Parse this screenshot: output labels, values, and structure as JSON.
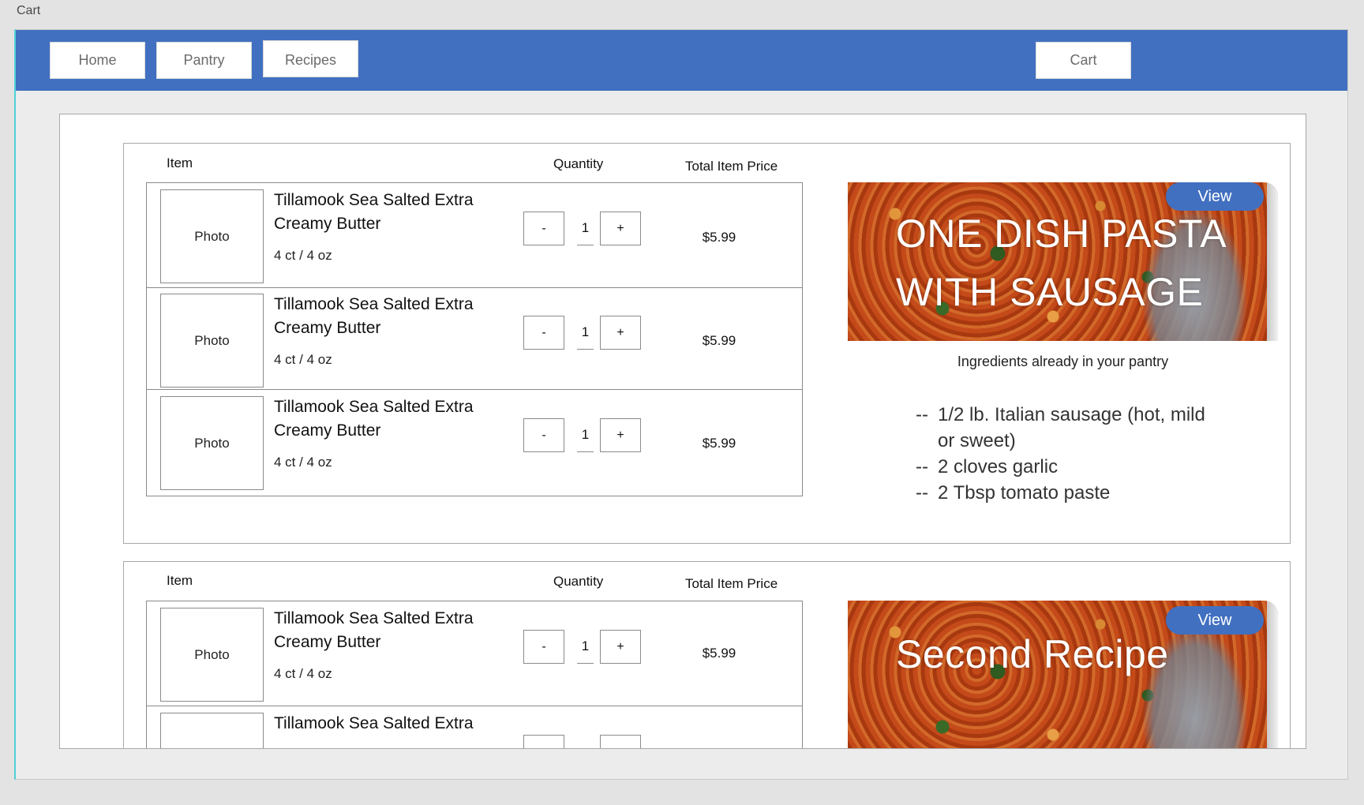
{
  "screen": {
    "title": "Cart"
  },
  "nav": {
    "home": "Home",
    "pantry": "Pantry",
    "recipes": "Recipes",
    "cart": "Cart"
  },
  "colors": {
    "header_bar": "#4170c1",
    "view_button": "#4170c1",
    "frame_accent": "#4fd1d9"
  },
  "columns": {
    "item": "Item",
    "quantity": "Quantity",
    "total_price": "Total Item Price"
  },
  "carts": [
    {
      "recipe": {
        "title_line1": "ONE DISH PASTA",
        "title_line2": "WITH SAUSAGE",
        "view_label": "View",
        "pantry_heading": "Ingredients already in your pantry",
        "pantry_dash": "--",
        "pantry_items": [
          {
            "line1": "1/2 lb. Italian sausage (hot, mild",
            "line2": "or sweet)"
          },
          {
            "line1": "2 cloves garlic"
          },
          {
            "line1": "2 Tbsp tomato paste"
          }
        ]
      },
      "items": [
        {
          "photo": "Photo",
          "name_line1": "Tillamook Sea Salted Extra",
          "name_line2": "Creamy Butter",
          "size": "4 ct / 4 oz",
          "minus": "-",
          "qty": "1",
          "plus": "+",
          "price": "$5.99"
        },
        {
          "photo": "Photo",
          "name_line1": "Tillamook Sea Salted Extra",
          "name_line2": "Creamy Butter",
          "size": "4 ct / 4 oz",
          "minus": "-",
          "qty": "1",
          "plus": "+",
          "price": "$5.99"
        },
        {
          "photo": "Photo",
          "name_line1": "Tillamook Sea Salted Extra",
          "name_line2": "Creamy Butter",
          "size": "4 ct / 4 oz",
          "minus": "-",
          "qty": "1",
          "plus": "+",
          "price": "$5.99"
        }
      ]
    },
    {
      "recipe": {
        "title_line1": "Second Recipe",
        "view_label": "View"
      },
      "items": [
        {
          "photo": "Photo",
          "name_line1": "Tillamook Sea Salted Extra",
          "name_line2": "Creamy Butter",
          "size": "4 ct / 4 oz",
          "minus": "-",
          "qty": "1",
          "plus": "+",
          "price": "$5.99"
        },
        {
          "name_line1": "Tillamook Sea Salted Extra"
        }
      ]
    }
  ]
}
